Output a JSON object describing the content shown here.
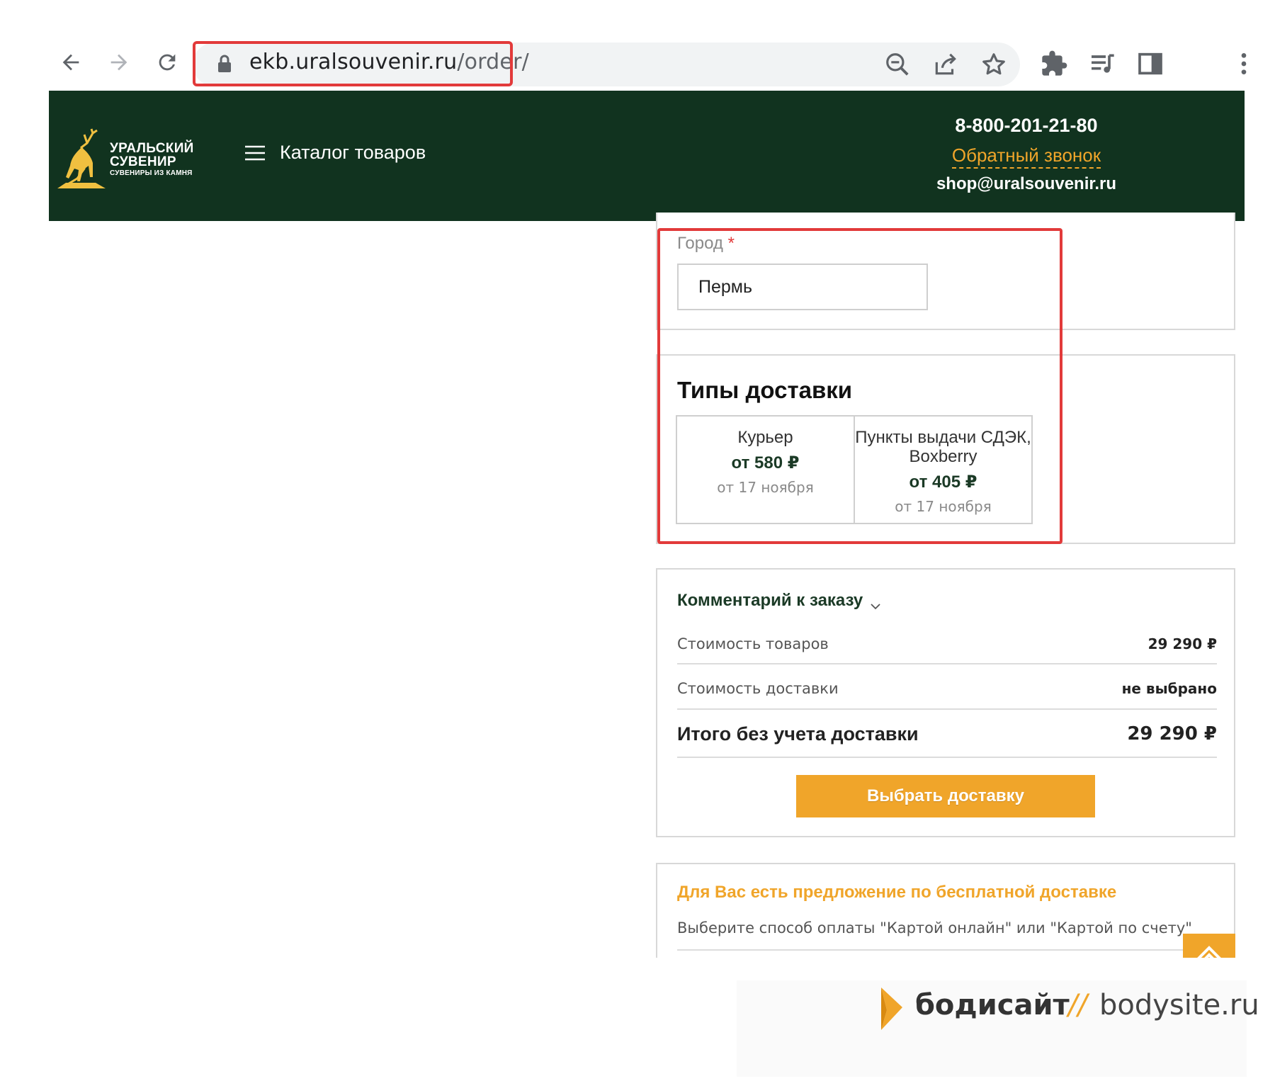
{
  "browser": {
    "url_host": "ekb.uralsouvenir.ru",
    "url_path": "/order/",
    "icons": [
      "back-icon",
      "forward-icon",
      "reload-icon",
      "lock-icon",
      "zoom-out-icon",
      "share-icon",
      "star-icon",
      "extensions-icon",
      "media-icon",
      "side-panel-icon",
      "menu-icon"
    ]
  },
  "header": {
    "logo": {
      "line1": "УРАЛЬСКИЙ",
      "line2": "СУВЕНИР",
      "line3": "СУВЕНИРЫ ИЗ КАМНЯ"
    },
    "catalog_label": "Каталог товаров",
    "phone": "8-800-201-21-80",
    "callback": "Обратный звонок",
    "email": "shop@uralsouvenir.ru"
  },
  "city": {
    "label": "Город",
    "required_mark": "*",
    "value": "Пермь"
  },
  "delivery": {
    "title": "Типы доставки",
    "options": [
      {
        "name": "Курьер",
        "price": "от 580 ₽",
        "date": "от 17 ноября"
      },
      {
        "name": "Пункты выдачи СДЭК, Boxberry",
        "price": "от 405 ₽",
        "date": "от 17 ноября"
      }
    ]
  },
  "summary": {
    "comment_toggle": "Комментарий к заказу",
    "rows": [
      {
        "label": "Стоимость товаров",
        "value": "29 290 ₽"
      },
      {
        "label": "Стоимость доставки",
        "value": "не выбрано"
      },
      {
        "label": "Итого без учета доставки",
        "value": "29 290 ₽"
      }
    ],
    "button": "Выбрать доставку"
  },
  "promo": {
    "title": "Для Вас есть предложение по бесплатной доставке",
    "text": "Выберите способ оплаты \"Картой онлайн\" или \"Картой по счету\""
  },
  "watermark": {
    "brand": "бодисайт",
    "separator": "//",
    "domain": "bodysite.ru"
  },
  "colors": {
    "header_bg": "#11331f",
    "accent": "#f0a52a",
    "highlight": "#e23a3a",
    "dark_green_text": "#1b3a26"
  }
}
